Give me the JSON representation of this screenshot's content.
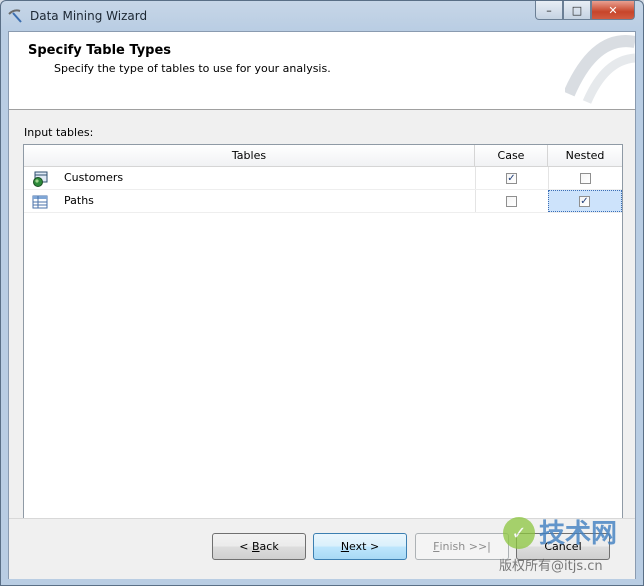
{
  "window": {
    "title": "Data Mining Wizard",
    "controls": {
      "minimize": "–",
      "maximize": "□",
      "close": "✕"
    }
  },
  "header": {
    "title": "Specify Table Types",
    "subtitle": "Specify the type of tables to use for your analysis."
  },
  "input_tables": {
    "label": "Input tables:",
    "columns": [
      "Tables",
      "Case",
      "Nested"
    ],
    "rows": [
      {
        "name": "Customers",
        "icon": "database-table-icon",
        "case": true,
        "nested": false
      },
      {
        "name": "Paths",
        "icon": "table-grid-icon",
        "case": false,
        "nested": true,
        "selected_cell": "nested"
      }
    ]
  },
  "buttons": {
    "back": {
      "prefix": "< ",
      "mnemonic": "B",
      "rest": "ack"
    },
    "next": {
      "mnemonic": "N",
      "rest": "ext >"
    },
    "finish": {
      "mnemonic": "F",
      "rest": "inish >>|"
    },
    "cancel": "Cancel"
  },
  "watermark": {
    "text": "技术网",
    "url": "版权所有@itjs.cn"
  },
  "colors": {
    "title_bar": "#b9cde3",
    "selected_cell": "#cde3fb",
    "close_button": "#c7452a"
  }
}
